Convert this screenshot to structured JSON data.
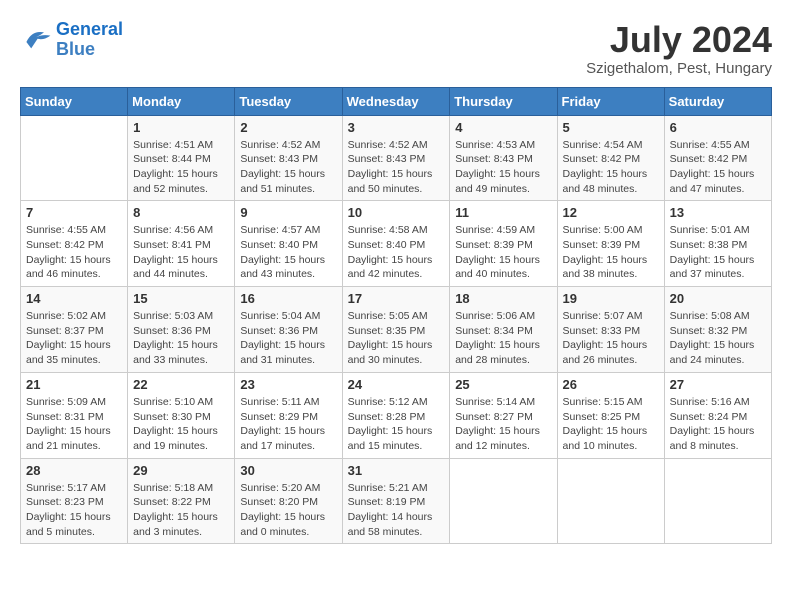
{
  "header": {
    "logo_line1": "General",
    "logo_line2": "Blue",
    "month_year": "July 2024",
    "location": "Szigethalom, Pest, Hungary"
  },
  "days_of_week": [
    "Sunday",
    "Monday",
    "Tuesday",
    "Wednesday",
    "Thursday",
    "Friday",
    "Saturday"
  ],
  "weeks": [
    [
      {
        "day": "",
        "info": ""
      },
      {
        "day": "1",
        "info": "Sunrise: 4:51 AM\nSunset: 8:44 PM\nDaylight: 15 hours\nand 52 minutes."
      },
      {
        "day": "2",
        "info": "Sunrise: 4:52 AM\nSunset: 8:43 PM\nDaylight: 15 hours\nand 51 minutes."
      },
      {
        "day": "3",
        "info": "Sunrise: 4:52 AM\nSunset: 8:43 PM\nDaylight: 15 hours\nand 50 minutes."
      },
      {
        "day": "4",
        "info": "Sunrise: 4:53 AM\nSunset: 8:43 PM\nDaylight: 15 hours\nand 49 minutes."
      },
      {
        "day": "5",
        "info": "Sunrise: 4:54 AM\nSunset: 8:42 PM\nDaylight: 15 hours\nand 48 minutes."
      },
      {
        "day": "6",
        "info": "Sunrise: 4:55 AM\nSunset: 8:42 PM\nDaylight: 15 hours\nand 47 minutes."
      }
    ],
    [
      {
        "day": "7",
        "info": "Sunrise: 4:55 AM\nSunset: 8:42 PM\nDaylight: 15 hours\nand 46 minutes."
      },
      {
        "day": "8",
        "info": "Sunrise: 4:56 AM\nSunset: 8:41 PM\nDaylight: 15 hours\nand 44 minutes."
      },
      {
        "day": "9",
        "info": "Sunrise: 4:57 AM\nSunset: 8:40 PM\nDaylight: 15 hours\nand 43 minutes."
      },
      {
        "day": "10",
        "info": "Sunrise: 4:58 AM\nSunset: 8:40 PM\nDaylight: 15 hours\nand 42 minutes."
      },
      {
        "day": "11",
        "info": "Sunrise: 4:59 AM\nSunset: 8:39 PM\nDaylight: 15 hours\nand 40 minutes."
      },
      {
        "day": "12",
        "info": "Sunrise: 5:00 AM\nSunset: 8:39 PM\nDaylight: 15 hours\nand 38 minutes."
      },
      {
        "day": "13",
        "info": "Sunrise: 5:01 AM\nSunset: 8:38 PM\nDaylight: 15 hours\nand 37 minutes."
      }
    ],
    [
      {
        "day": "14",
        "info": "Sunrise: 5:02 AM\nSunset: 8:37 PM\nDaylight: 15 hours\nand 35 minutes."
      },
      {
        "day": "15",
        "info": "Sunrise: 5:03 AM\nSunset: 8:36 PM\nDaylight: 15 hours\nand 33 minutes."
      },
      {
        "day": "16",
        "info": "Sunrise: 5:04 AM\nSunset: 8:36 PM\nDaylight: 15 hours\nand 31 minutes."
      },
      {
        "day": "17",
        "info": "Sunrise: 5:05 AM\nSunset: 8:35 PM\nDaylight: 15 hours\nand 30 minutes."
      },
      {
        "day": "18",
        "info": "Sunrise: 5:06 AM\nSunset: 8:34 PM\nDaylight: 15 hours\nand 28 minutes."
      },
      {
        "day": "19",
        "info": "Sunrise: 5:07 AM\nSunset: 8:33 PM\nDaylight: 15 hours\nand 26 minutes."
      },
      {
        "day": "20",
        "info": "Sunrise: 5:08 AM\nSunset: 8:32 PM\nDaylight: 15 hours\nand 24 minutes."
      }
    ],
    [
      {
        "day": "21",
        "info": "Sunrise: 5:09 AM\nSunset: 8:31 PM\nDaylight: 15 hours\nand 21 minutes."
      },
      {
        "day": "22",
        "info": "Sunrise: 5:10 AM\nSunset: 8:30 PM\nDaylight: 15 hours\nand 19 minutes."
      },
      {
        "day": "23",
        "info": "Sunrise: 5:11 AM\nSunset: 8:29 PM\nDaylight: 15 hours\nand 17 minutes."
      },
      {
        "day": "24",
        "info": "Sunrise: 5:12 AM\nSunset: 8:28 PM\nDaylight: 15 hours\nand 15 minutes."
      },
      {
        "day": "25",
        "info": "Sunrise: 5:14 AM\nSunset: 8:27 PM\nDaylight: 15 hours\nand 12 minutes."
      },
      {
        "day": "26",
        "info": "Sunrise: 5:15 AM\nSunset: 8:25 PM\nDaylight: 15 hours\nand 10 minutes."
      },
      {
        "day": "27",
        "info": "Sunrise: 5:16 AM\nSunset: 8:24 PM\nDaylight: 15 hours\nand 8 minutes."
      }
    ],
    [
      {
        "day": "28",
        "info": "Sunrise: 5:17 AM\nSunset: 8:23 PM\nDaylight: 15 hours\nand 5 minutes."
      },
      {
        "day": "29",
        "info": "Sunrise: 5:18 AM\nSunset: 8:22 PM\nDaylight: 15 hours\nand 3 minutes."
      },
      {
        "day": "30",
        "info": "Sunrise: 5:20 AM\nSunset: 8:20 PM\nDaylight: 15 hours\nand 0 minutes."
      },
      {
        "day": "31",
        "info": "Sunrise: 5:21 AM\nSunset: 8:19 PM\nDaylight: 14 hours\nand 58 minutes."
      },
      {
        "day": "",
        "info": ""
      },
      {
        "day": "",
        "info": ""
      },
      {
        "day": "",
        "info": ""
      }
    ]
  ]
}
